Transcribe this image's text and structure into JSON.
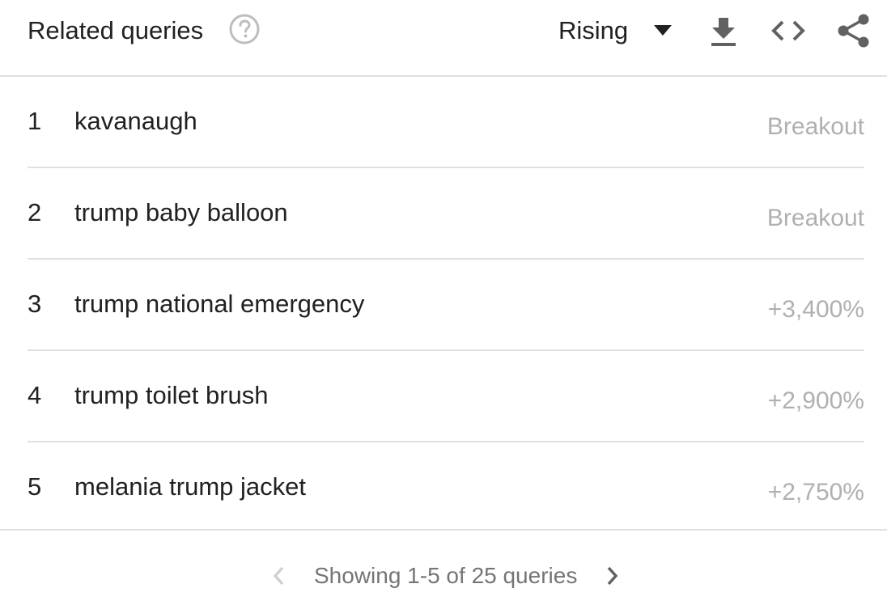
{
  "header": {
    "title": "Related queries",
    "help_icon": "question-circle-icon",
    "selector_value": "Rising",
    "actions": [
      "download-icon",
      "embed-code-icon",
      "share-icon"
    ]
  },
  "rows": [
    {
      "rank": "1",
      "query": "kavanaugh",
      "value": "Breakout"
    },
    {
      "rank": "2",
      "query": "trump baby balloon",
      "value": "Breakout"
    },
    {
      "rank": "3",
      "query": "trump national emergency",
      "value": "+3,400%"
    },
    {
      "rank": "4",
      "query": "trump toilet brush",
      "value": "+2,900%"
    },
    {
      "rank": "5",
      "query": "melania trump jacket",
      "value": "+2,750%"
    }
  ],
  "pagination": {
    "text": "Showing 1-5 of 25 queries",
    "prev_icon": "chevron-left-icon",
    "next_icon": "chevron-right-icon"
  },
  "colors": {
    "text": "#212121",
    "muted": "#b0b0b0",
    "divider": "#e0e0e0",
    "icon": "#616161"
  }
}
